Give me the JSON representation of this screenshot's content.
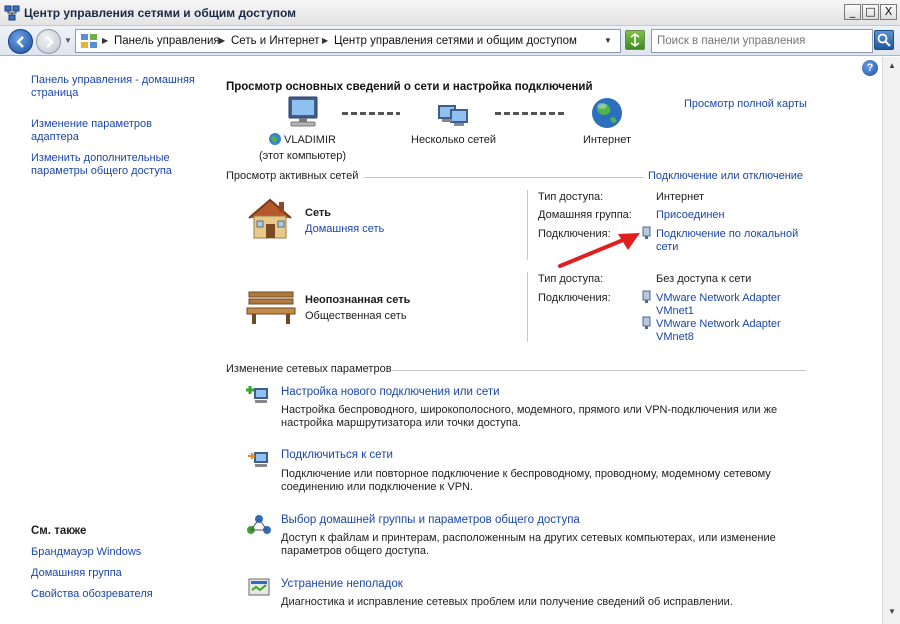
{
  "window": {
    "title": "Центр управления сетями и общим доступом",
    "minimize_glyph": "_",
    "maximize_glyph": "□",
    "close_glyph": "X"
  },
  "address": {
    "crumbs": [
      "Панель управления",
      "Сеть и Интернет",
      "Центр управления сетями и общим доступом"
    ],
    "search_placeholder": "Поиск в панели управления"
  },
  "sidebar": {
    "links": [
      {
        "label": "Панель управления - домашняя страница"
      },
      {
        "label": "Изменение параметров адаптера"
      },
      {
        "label": "Изменить дополнительные параметры общего доступа"
      }
    ],
    "see_also_heading": "См. также",
    "see_also": [
      {
        "label": "Брандмауэр Windows"
      },
      {
        "label": "Домашняя группа"
      },
      {
        "label": "Свойства обозревателя"
      }
    ]
  },
  "main": {
    "header": "Просмотр основных сведений о сети и настройка подключений",
    "full_map_link": "Просмотр полной карты",
    "map": {
      "computer_name": "VLADIMIR",
      "computer_sub": "(этот компьютер)",
      "middle": "Несколько сетей",
      "internet": "Интернет"
    },
    "active_networks_title": "Просмотр активных сетей",
    "connect_disconnect_link": "Подключение или отключение",
    "networks": [
      {
        "name": "Сеть",
        "type_link": "Домашняя сеть",
        "access_label": "Тип доступа:",
        "access_value": "Интернет",
        "homegroup_label": "Домашняя группа:",
        "homegroup_value": "Присоединен",
        "connections_label": "Подключения:",
        "connection_line1": "Подключение по локальной",
        "connection_line2": "сети"
      },
      {
        "name": "Неопознанная сеть",
        "type_text": "Общественная сеть",
        "access_label": "Тип доступа:",
        "access_value": "Без доступа к сети",
        "connections_label": "Подключения:",
        "connections": [
          {
            "line1": "VMware Network Adapter",
            "line2": "VMnet1"
          },
          {
            "line1": "VMware Network Adapter",
            "line2": "VMnet8"
          }
        ]
      }
    ],
    "change_settings_title": "Изменение сетевых параметров",
    "tasks": [
      {
        "title": "Настройка нового подключения или сети",
        "desc_line1": "Настройка беспроводного, широкополосного, модемного, прямого или VPN-подключения или же",
        "desc_line2": "настройка маршрутизатора или точки доступа."
      },
      {
        "title": "Подключиться к сети",
        "desc_line1": "Подключение или повторное подключение к беспроводному, проводному, модемному сетевому",
        "desc_line2": "соединению или подключение к VPN."
      },
      {
        "title": "Выбор домашней группы и параметров общего доступа",
        "desc_line1": "Доступ к файлам и принтерам, расположенным на других сетевых компьютерах, или изменение",
        "desc_line2": "параметров общего доступа."
      },
      {
        "title": "Устранение неполадок",
        "desc_line1": "Диагностика и исправление сетевых проблем или получение сведений об исправлении."
      }
    ]
  },
  "colors": {
    "link": "#1b47a6",
    "annotation_arrow": "#e02020"
  }
}
